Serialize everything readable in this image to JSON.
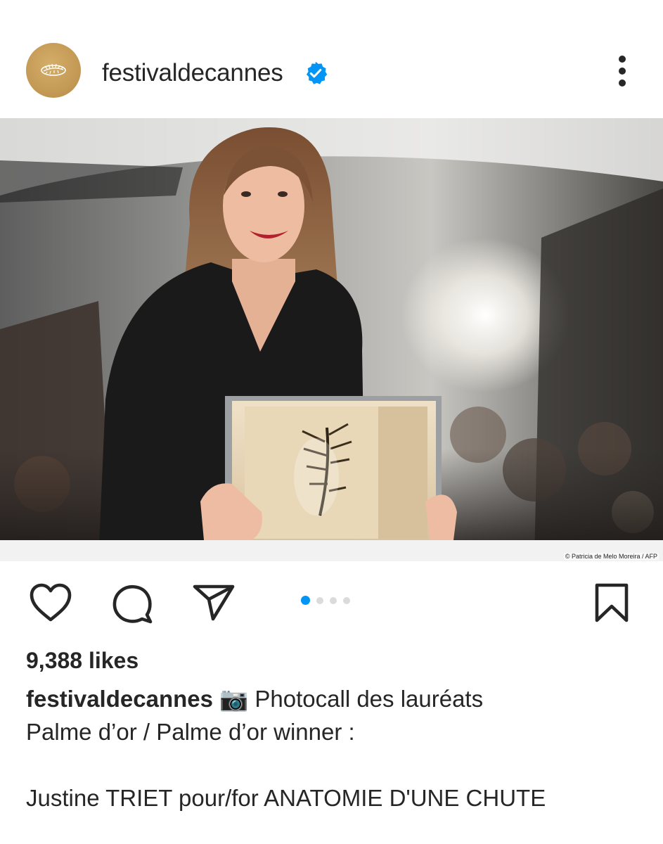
{
  "post": {
    "username": "festivaldecannes",
    "verified": true,
    "likes": "9,388 likes",
    "photo_credit": "© Patricia de Melo Moreira / AFP",
    "carousel": {
      "total": 4,
      "active_index": 0
    },
    "caption": {
      "username": "festivaldecannes",
      "emoji": "📷",
      "line1": "Photocall des lauréats",
      "line2": "Palme d’or / Palme d’or winner :",
      "line3": "Justine TRIET pour/for ANATOMIE D'UNE CHUTE"
    }
  },
  "icons": {
    "like": "heart-icon",
    "comment": "comment-bubble-icon",
    "share": "paper-plane-icon",
    "save": "bookmark-icon",
    "more": "more-vertical-icon",
    "verified": "verified-badge-icon"
  },
  "colors": {
    "text": "#262626",
    "verified_blue": "#0095f6",
    "avatar_gold": "#c49a55",
    "dot_inactive": "#dbdbdb"
  }
}
